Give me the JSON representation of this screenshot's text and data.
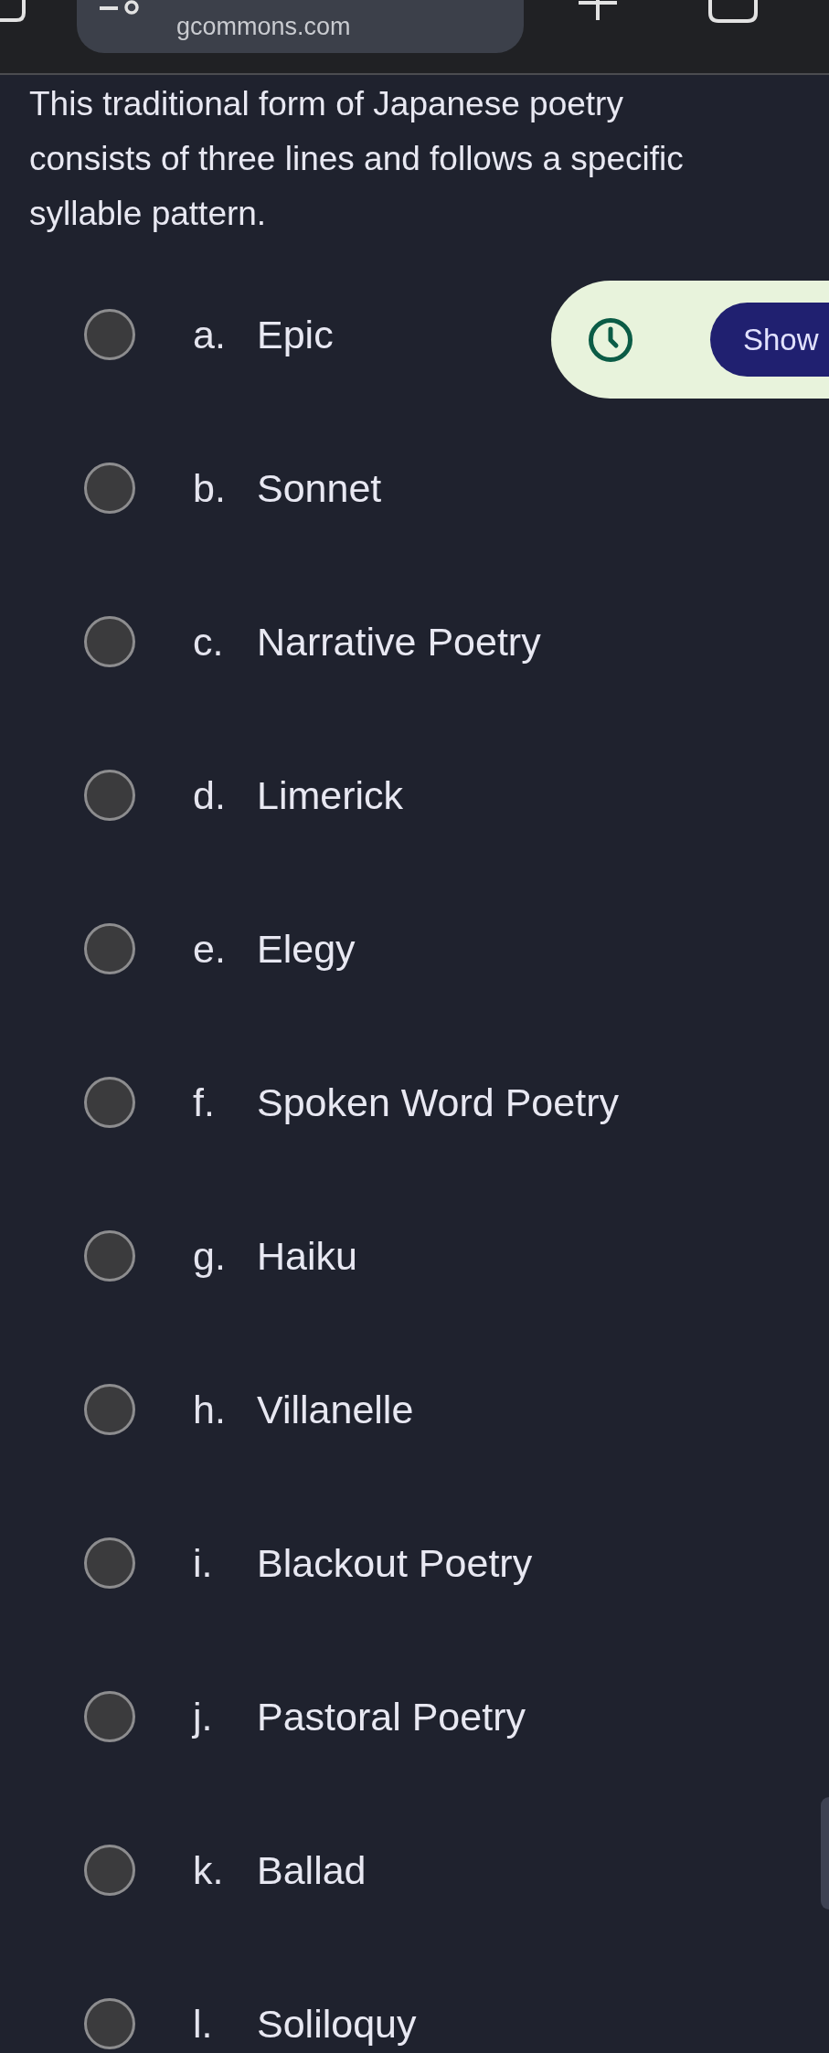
{
  "browser_bar": {
    "url": "gcommons.com"
  },
  "question": {
    "text": "This traditional form of Japanese poetry consists of three lines and follows a specific syllable pattern."
  },
  "timer_widget": {
    "button": "Show"
  },
  "options": [
    {
      "letter": "a.",
      "label": "Epic",
      "selected": false
    },
    {
      "letter": "b.",
      "label": "Sonnet",
      "selected": false
    },
    {
      "letter": "c.",
      "label": "Narrative Poetry",
      "selected": false
    },
    {
      "letter": "d.",
      "label": "Limerick",
      "selected": false
    },
    {
      "letter": "e.",
      "label": "Elegy",
      "selected": false
    },
    {
      "letter": "f.",
      "label": "Spoken Word Poetry",
      "selected": false
    },
    {
      "letter": "g.",
      "label": "Haiku",
      "selected": false
    },
    {
      "letter": "h.",
      "label": "Villanelle",
      "selected": false
    },
    {
      "letter": "i.",
      "label": "Blackout Poetry",
      "selected": false
    },
    {
      "letter": "j.",
      "label": "Pastoral Poetry",
      "selected": false
    },
    {
      "letter": "k.",
      "label": "Ballad",
      "selected": false
    },
    {
      "letter": "l.",
      "label": "Soliloquy",
      "selected": false
    }
  ]
}
